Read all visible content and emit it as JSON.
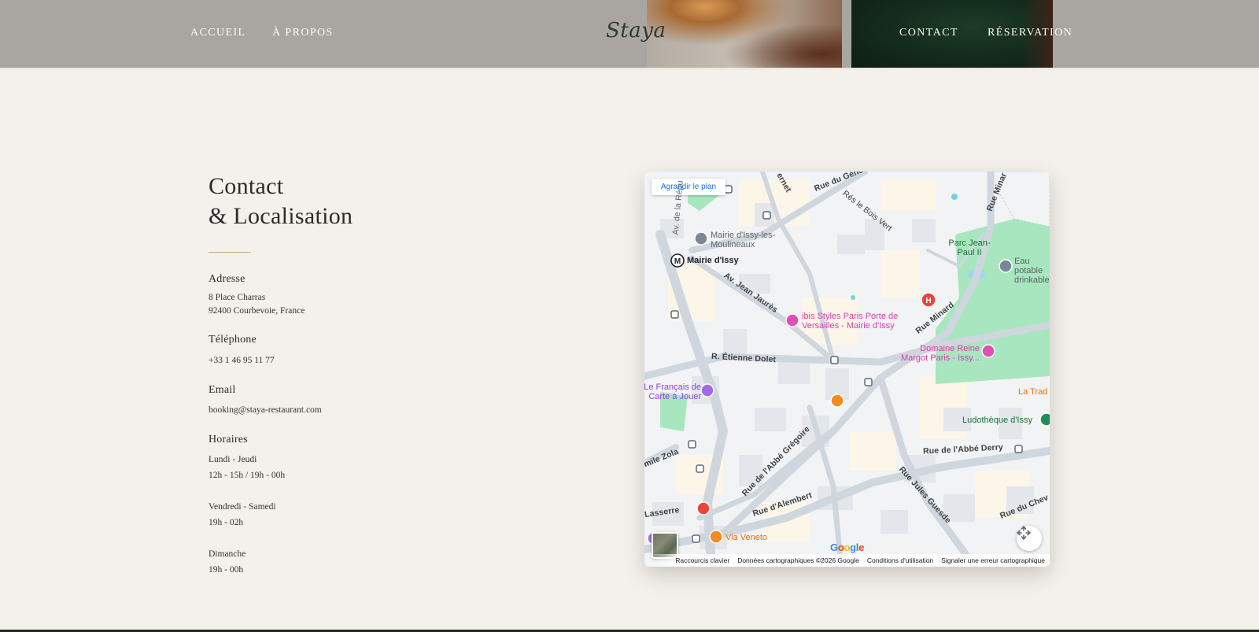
{
  "header": {
    "nav_left": [
      "ACCUEIL",
      "À PROPOS"
    ],
    "logo": "Staya",
    "nav_right": [
      "CONTACT",
      "RÉSERVATION"
    ]
  },
  "contact": {
    "title_line1": "Contact",
    "title_line2": "& Localisation",
    "address_label": "Adresse",
    "address_line1": "8 Place Charras",
    "address_line2": "92400 Courbevoie, France",
    "phone_label": "Téléphone",
    "phone": "+33 1 46 95 11 77",
    "email_label": "Email",
    "email": "booking@staya-restaurant.com",
    "hours_label": "Horaires",
    "hours": [
      {
        "days": "Lundi - Jeudi",
        "time": "12h - 15h / 19h - 00h"
      },
      {
        "days": "Vendredi - Samedi",
        "time": "19h - 02h"
      },
      {
        "days": "Dimanche",
        "time": "19h - 00h"
      }
    ]
  },
  "map": {
    "enlarge_label": "Agrandir le plan",
    "places": {
      "mairie": "Mairie d'Issy-les-Moulineaux",
      "metro": "Mairie d'Issy",
      "parc": "Parc Jean-Paul II",
      "eau": "Eau potable drinkable",
      "ibis": "ibis Styles Paris Porte de Versailles - Mairie d'Issy",
      "domaine": "Domaine Reine Margot Paris - Issy...",
      "carte": "Le Français de Carte à Jouer",
      "latrad": "La Trad",
      "ludo": "Ludothèque d'Issy",
      "veneto": "Via Veneto"
    },
    "streets": {
      "rue_general": "Rue du Géné",
      "res_bois": "Rés le Bois Vert",
      "av_jaures": "Av. Jean Jaurès",
      "rue_minard": "Rue Minard",
      "rue_minard_top": "Rue Minar",
      "etienne": "R. Étienne Dolet",
      "abbe_derry": "Rue de l'Abbé Derry",
      "abbe_gregoire": "Rue de l'Abbé Grégoire",
      "zola": "mile Zola",
      "alembert": "Rue d'Alembert",
      "guesde": "Rue Jules Guesde",
      "lasserre": "Lasserre",
      "chev": "Rue du Chev",
      "av_rep": "Av. de la Répu",
      "ernet": "ernet"
    },
    "google": "Google",
    "attribution": [
      "Raccourcis clavier",
      "Données cartographiques ©2026 Google",
      "Conditions d'utilisation",
      "Signaler une erreur cartographique"
    ]
  },
  "colors": {
    "background": "#f4f0eb",
    "header": "#a9a6a1",
    "accent_rule": "#c8a880",
    "hotel_pink": "#d63fb0",
    "food_orange": "#e8710a",
    "park_green": "#a8e6bf"
  }
}
